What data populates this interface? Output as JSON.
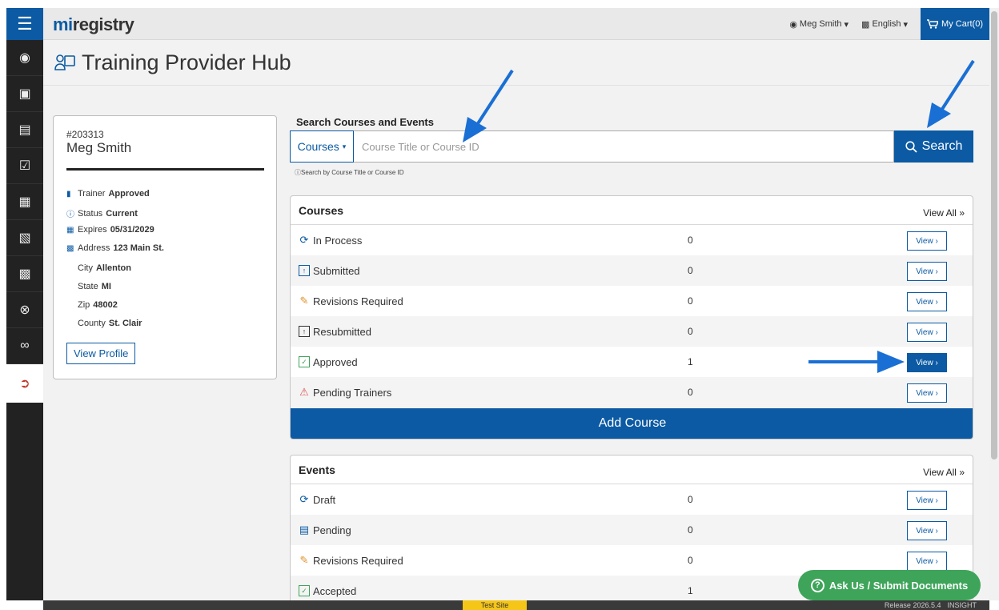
{
  "header": {
    "logo_mi": "mi",
    "logo_rest": "registry",
    "user_menu": "Meg Smith",
    "language": "English",
    "cart": "My Cart(0)"
  },
  "page": {
    "title": "Training Provider Hub"
  },
  "profile": {
    "id": "#203313",
    "name": "Meg Smith",
    "trainer_label": "Trainer",
    "trainer_value": "Approved",
    "status_label": "Status",
    "status_value": "Current",
    "expires_label": "Expires",
    "expires_value": "05/31/2029",
    "address_label": "Address",
    "address_value": "123 Main St.",
    "city_label": "City",
    "city_value": "Allenton",
    "state_label": "State",
    "state_value": "MI",
    "zip_label": "Zip",
    "zip_value": "48002",
    "county_label": "County",
    "county_value": "St. Clair",
    "view_profile": "View Profile"
  },
  "search": {
    "label": "Search Courses and Events",
    "dropdown": "Courses",
    "placeholder": "Course Title or Course ID",
    "button": "Search",
    "hint": "Search by Course Title or Course ID"
  },
  "courses": {
    "title": "Courses",
    "view_all": "View All",
    "view_label": "View",
    "rows": [
      {
        "label": "In Process",
        "count": "0",
        "icon": "refresh-icon"
      },
      {
        "label": "Submitted",
        "count": "0",
        "icon": "file-upload-icon"
      },
      {
        "label": "Revisions Required",
        "count": "0",
        "icon": "edit-icon"
      },
      {
        "label": "Resubmitted",
        "count": "0",
        "icon": "file-upload-icon"
      },
      {
        "label": "Approved",
        "count": "1",
        "icon": "check-square-icon"
      },
      {
        "label": "Pending Trainers",
        "count": "0",
        "icon": "warning-icon"
      }
    ],
    "add_button": "Add Course"
  },
  "events": {
    "title": "Events",
    "view_all": "View All",
    "view_label": "View",
    "rows": [
      {
        "label": "Draft",
        "count": "0",
        "icon": "refresh-icon"
      },
      {
        "label": "Pending",
        "count": "0",
        "icon": "pending-doc-icon"
      },
      {
        "label": "Revisions Required",
        "count": "0",
        "icon": "edit-icon"
      },
      {
        "label": "Accepted",
        "count": "1",
        "icon": "check-square-icon"
      }
    ]
  },
  "help_button": "Ask Us / Submit Documents",
  "footer": {
    "test_site": "Test Site",
    "release": "Release 2026.5.4",
    "brand": "INSIGHT"
  },
  "colors": {
    "primary": "#0b5aa3",
    "sidebar": "#222222",
    "help": "#3ea45a",
    "warning": "#d9534f",
    "edit": "#e0922b",
    "success": "#3ea45a"
  }
}
